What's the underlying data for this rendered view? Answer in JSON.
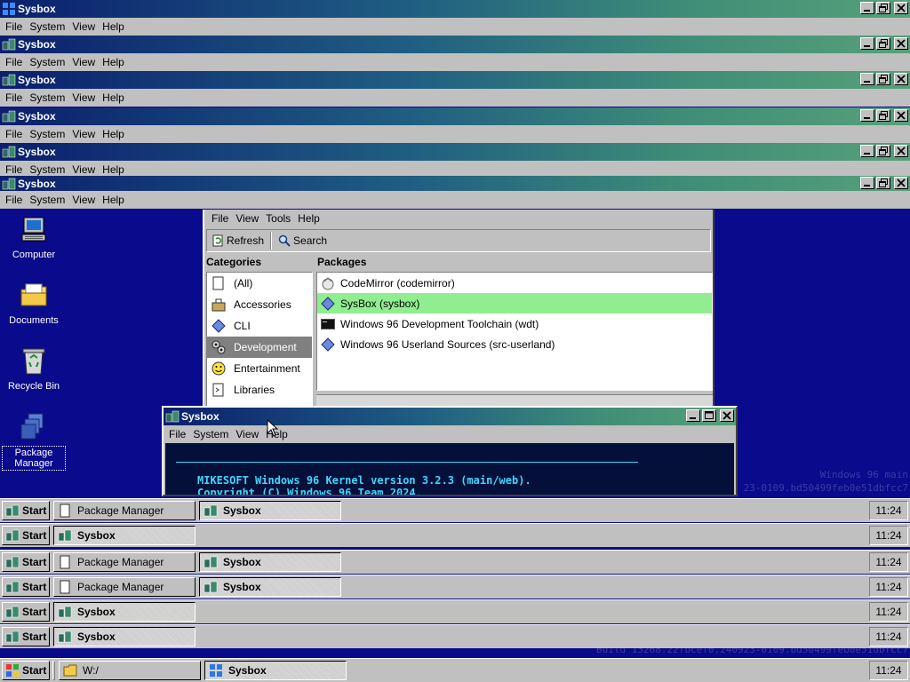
{
  "desktop": {
    "icons": [
      {
        "label": "Computer",
        "icon": "computer-icon"
      },
      {
        "label": "Documents",
        "icon": "folder-icon"
      },
      {
        "label": "Recycle Bin",
        "icon": "recycle-bin-icon"
      },
      {
        "label": "Package Manager",
        "icon": "package-manager-icon"
      }
    ],
    "watermark": {
      "product": "Windows 96 main",
      "build_right": "23-0109.bd50499feb0e51dbfcc7",
      "build_bottom": "Build 13268.22fbcef0.240923-0109.bd50499feb0e51dbfcc7"
    }
  },
  "sysbox_strips": [
    {
      "title": "Sysbox",
      "menu": [
        "File",
        "System",
        "View",
        "Help"
      ]
    },
    {
      "title": "Sysbox",
      "menu": [
        "File",
        "System",
        "View",
        "Help"
      ]
    },
    {
      "title": "Sysbox",
      "menu": [
        "File",
        "System",
        "View",
        "Help"
      ]
    },
    {
      "title": "Sysbox",
      "menu": [
        "File",
        "System",
        "View",
        "Help"
      ]
    },
    {
      "title": "Sysbox",
      "menu": [
        "File",
        "System",
        "View",
        "Help"
      ]
    },
    {
      "title": "Sysbox",
      "menu": [
        "File",
        "System",
        "View",
        "Help"
      ]
    }
  ],
  "package_manager": {
    "menu": [
      "File",
      "View",
      "Tools",
      "Help"
    ],
    "toolbar": {
      "refresh": "Refresh",
      "search": "Search"
    },
    "categories_heading": "Categories",
    "packages_heading": "Packages",
    "categories": [
      {
        "label": "(All)",
        "icon": "all-icon",
        "selected": false
      },
      {
        "label": "Accessories",
        "icon": "accessories-icon",
        "selected": false
      },
      {
        "label": "CLI",
        "icon": "cli-icon",
        "selected": false
      },
      {
        "label": "Development",
        "icon": "development-icon",
        "selected": true
      },
      {
        "label": "Entertainment",
        "icon": "entertainment-icon",
        "selected": false
      },
      {
        "label": "Libraries",
        "icon": "libraries-icon",
        "selected": false
      }
    ],
    "packages": [
      {
        "label": "CodeMirror (codemirror)",
        "icon": "codemirror-icon",
        "selected": false
      },
      {
        "label": "SysBox (sysbox)",
        "icon": "package-diamond-icon",
        "selected": true
      },
      {
        "label": "Windows 96 Development Toolchain (wdt)",
        "icon": "terminal-icon",
        "selected": false
      },
      {
        "label": "Windows 96 Userland Sources (src-userland)",
        "icon": "package-diamond-icon",
        "selected": false
      }
    ]
  },
  "terminal": {
    "title": "Sysbox",
    "menu": [
      "File",
      "System",
      "View",
      "Help"
    ],
    "line1": "MIKESOFT Windows 96 Kernel version 3.2.3 (main/web).",
    "line2": "Copyright (C) Windows 96 Team 2024."
  },
  "taskbars": [
    {
      "start": "Start",
      "tasks": [
        {
          "label": "Package Manager",
          "active": false,
          "icon": "package-icon"
        },
        {
          "label": "Sysbox",
          "active": true,
          "icon": "sysbox-icon"
        }
      ],
      "clock": "11:24"
    },
    {
      "start": "Start",
      "tasks": [
        {
          "label": "Sysbox",
          "active": true,
          "icon": "sysbox-icon"
        }
      ],
      "clock": "11:24"
    },
    {
      "start": "Start",
      "tasks": [
        {
          "label": "Package Manager",
          "active": false,
          "icon": "package-icon"
        },
        {
          "label": "Sysbox",
          "active": true,
          "icon": "sysbox-icon"
        }
      ],
      "clock": "11:24"
    },
    {
      "start": "Start",
      "tasks": [
        {
          "label": "Package Manager",
          "active": false,
          "icon": "package-icon"
        },
        {
          "label": "Sysbox",
          "active": true,
          "icon": "sysbox-icon"
        }
      ],
      "clock": "11:24"
    },
    {
      "start": "Start",
      "tasks": [
        {
          "label": "Sysbox",
          "active": true,
          "icon": "sysbox-icon"
        }
      ],
      "clock": "11:24"
    },
    {
      "start": "Start",
      "tasks": [
        {
          "label": "Sysbox",
          "active": true,
          "icon": "sysbox-icon"
        }
      ],
      "clock": "11:24"
    }
  ],
  "main_taskbar": {
    "start": "Start",
    "tasks": [
      {
        "label": "W:/",
        "active": false,
        "icon": "folder-icon"
      },
      {
        "label": "Sysbox",
        "active": true,
        "icon": "windows-icon"
      }
    ],
    "clock": "11:24"
  },
  "colors": {
    "desktop": "#0a0a8c",
    "terminal_bg": "#04103a",
    "terminal_text": "#3fd6ff",
    "selected_package": "#90ee90"
  }
}
